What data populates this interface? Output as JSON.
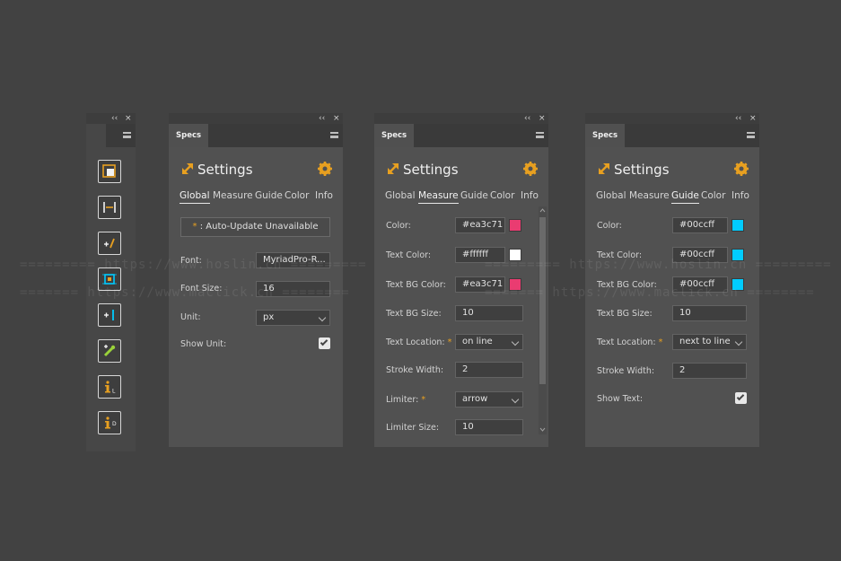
{
  "frame_controls": {
    "collapse": "‹‹",
    "close": "×"
  },
  "tab_label": "Specs",
  "settings_title": "Settings",
  "nav_tabs": [
    "Global",
    "Measure",
    "Guide",
    "Color",
    "Info"
  ],
  "colors": {
    "accent": "#e8a020",
    "pink": "#ea3c71",
    "white": "#ffffff",
    "cyan": "#00ccff"
  },
  "toolbar": {
    "tools": [
      {
        "icon": "area-icon"
      },
      {
        "icon": "width-icon"
      },
      {
        "icon": "add-distance-icon"
      },
      {
        "icon": "bounds-icon"
      },
      {
        "icon": "add-line-icon"
      },
      {
        "icon": "color-picker-icon"
      },
      {
        "icon": "info-l-icon",
        "letter": "L"
      },
      {
        "icon": "info-d-icon",
        "letter": "D"
      }
    ]
  },
  "global": {
    "update_button": ": Auto-Update Unavailable",
    "update_star": "*",
    "font_label": "Font:",
    "font_value": "MyriadPro-R...",
    "font_size_label": "Font Size:",
    "font_size_value": "16",
    "unit_label": "Unit:",
    "unit_value": "px",
    "show_unit_label": "Show Unit:",
    "show_unit_checked": true
  },
  "measure": {
    "color_label": "Color:",
    "color_value": "#ea3c71",
    "text_color_label": "Text Color:",
    "text_color_value": "#ffffff",
    "text_bg_color_label": "Text BG Color:",
    "text_bg_color_value": "#ea3c71",
    "text_bg_size_label": "Text BG Size:",
    "text_bg_size_value": "10",
    "text_location_label": "Text Location:",
    "text_location_value": "on line",
    "stroke_width_label": "Stroke Width:",
    "stroke_width_value": "2",
    "limiter_label": "Limiter:",
    "limiter_value": "arrow",
    "limiter_size_label": "Limiter Size:",
    "limiter_size_value": "10"
  },
  "guide": {
    "color_label": "Color:",
    "color_value": "#00ccff",
    "text_color_label": "Text Color:",
    "text_color_value": "#00ccff",
    "text_bg_color_label": "Text BG Color:",
    "text_bg_color_value": "#00ccff",
    "text_bg_size_label": "Text BG Size:",
    "text_bg_size_value": "10",
    "text_location_label": "Text Location:",
    "text_location_value": "next to line",
    "stroke_width_label": "Stroke Width:",
    "stroke_width_value": "2",
    "show_text_label": "Show Text:",
    "show_text_checked": true
  },
  "watermark": {
    "line1": "========= https://www.hoslin.cn =========",
    "line2": "======= https://www.maclick.cn ========"
  }
}
